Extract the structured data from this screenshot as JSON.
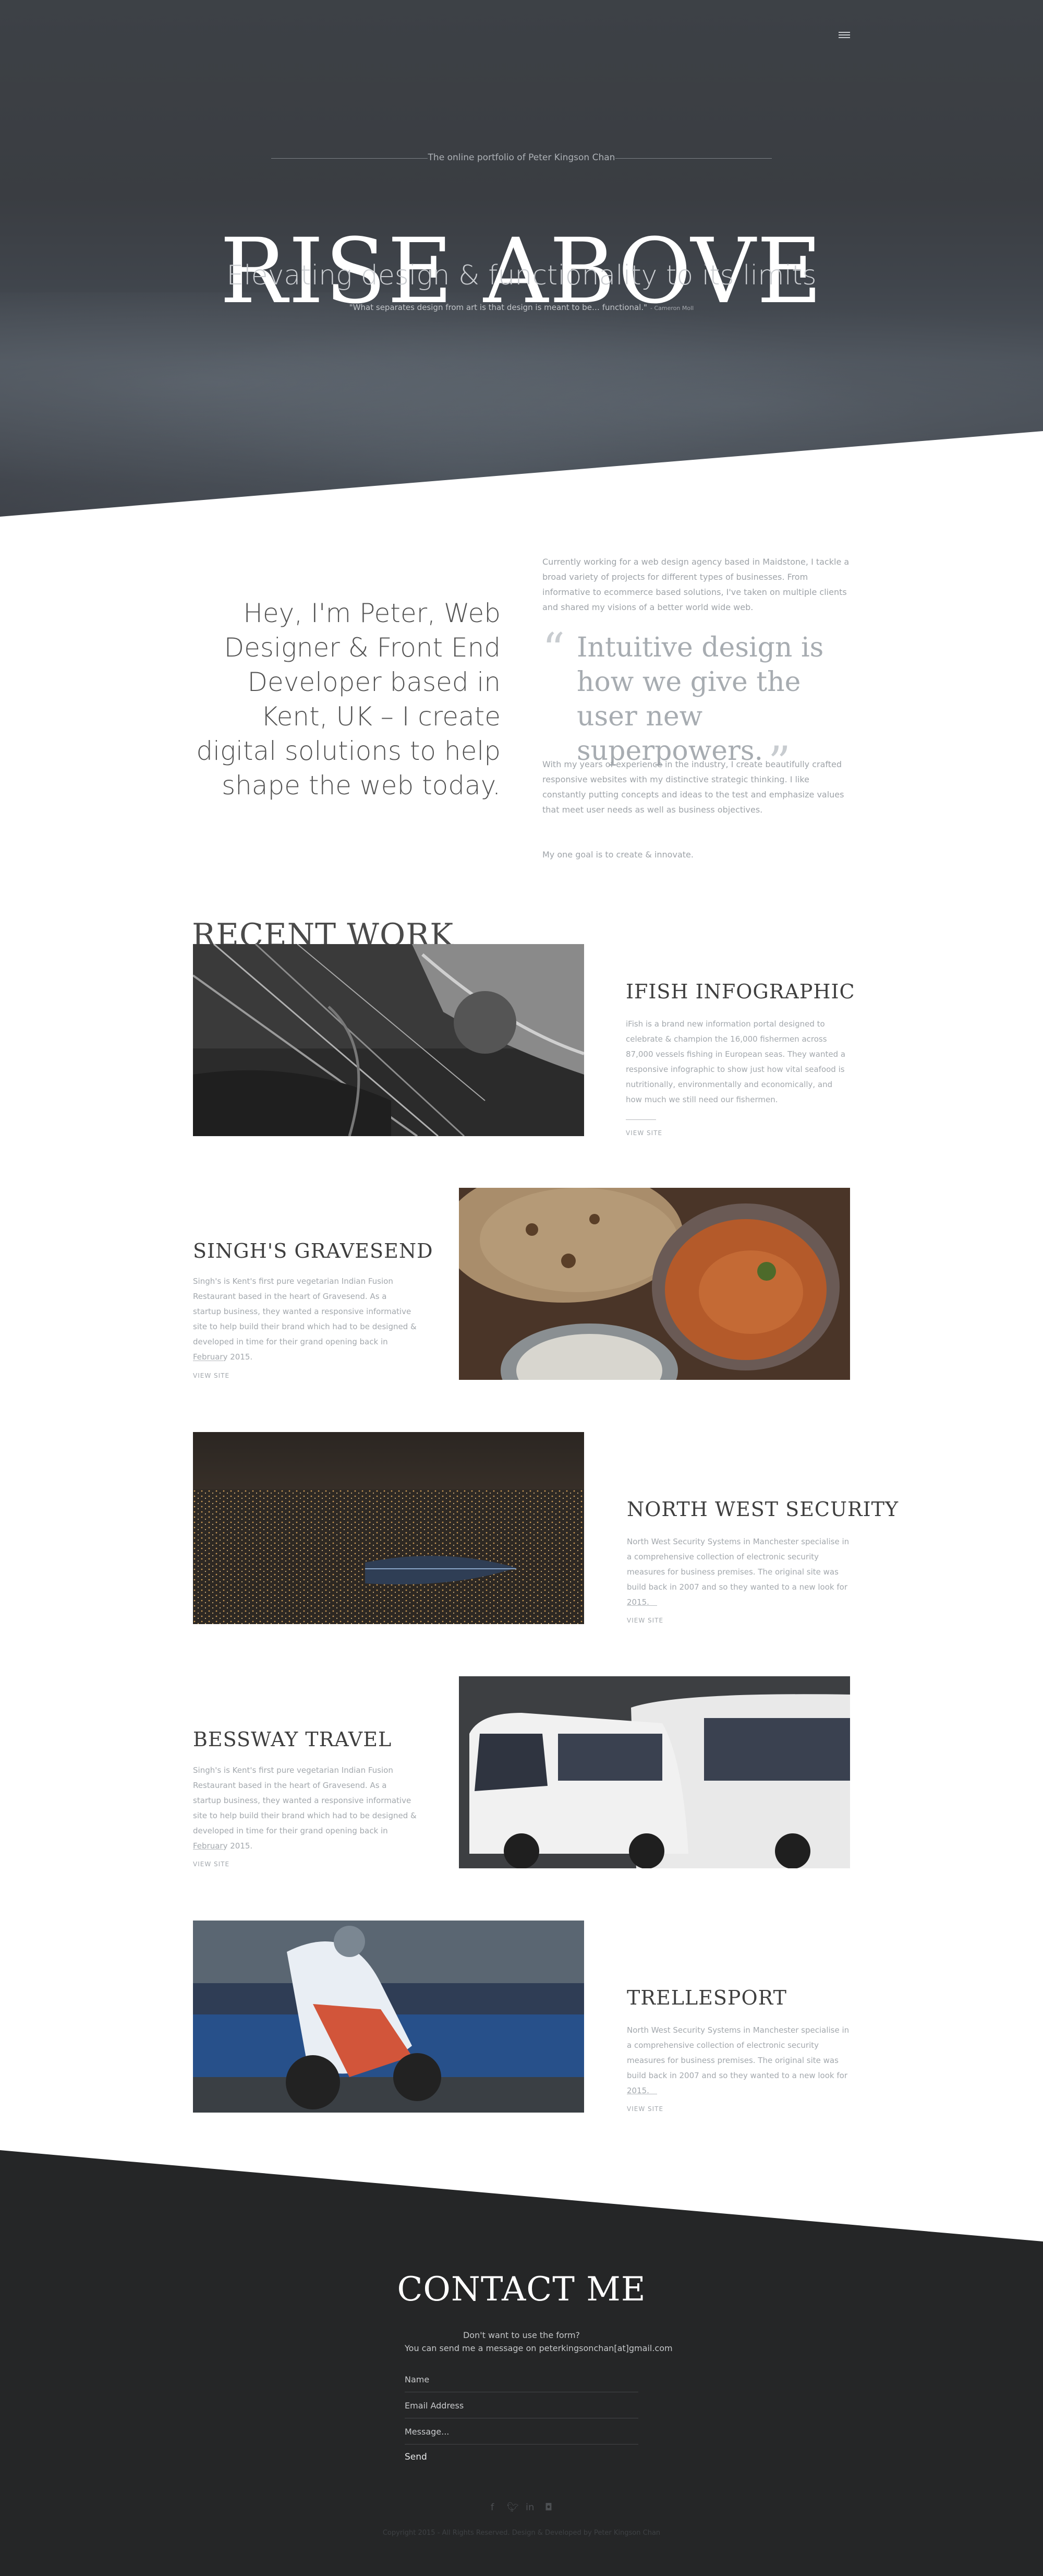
{
  "hero": {
    "tagline": "The online portfolio of Peter Kingson Chan",
    "title": "RISE ABOVE",
    "subtitle": "Elevating design & functionality to its limits",
    "quote": "\"What separates design from art is that design is meant to be… functional.\"",
    "quote_author": "- Cameron Moll",
    "menu_icon": "hamburger-menu-icon"
  },
  "about": {
    "intro": "Hey, I'm Peter, Web Designer & Front End Developer based in Kent, UK – I create digital solutions to help shape the web today.",
    "paragraph1": "Currently working for a web design agency based in Maidstone, I tackle a broad variety of projects for different types of businesses. From informative to ecommerce based solutions, I've taken on multiple clients and shared my visions of a better world wide web.",
    "pull_quote": "Intuitive design is how we give the user new superpowers.",
    "paragraph2": "With my years of experience in the industry, I create beautifully crafted responsive websites with my distinctive strategic thinking. I like constantly putting concepts and ideas to the test and emphasize values that meet user needs as well as business objectives.",
    "paragraph3": "My one goal is to create & innovate."
  },
  "work": {
    "heading": "RECENT WORK",
    "projects": [
      {
        "title": "IFISH INFOGRAPHIC",
        "description": "iFish is a brand new information portal designed to celebrate & champion the 16,000 fishermen across 87,000 vessels fishing in European seas. They wanted a responsive infographic to show just how vital seafood is nutritionally, environmentally and economically, and how much we still need our fishermen.",
        "link": "VIEW SITE"
      },
      {
        "title": "SINGH'S GRAVESEND",
        "description": "Singh's is Kent's first pure vegetarian Indian Fusion Restaurant based in the heart of Gravesend. As a startup business, they wanted a responsive informative site to help build their brand which had to be designed & developed in time for their grand opening back in February 2015.",
        "link": "VIEW SITE"
      },
      {
        "title": "NORTH WEST SECURITY",
        "description": "North West Security Systems in Manchester specialise in a comprehensive collection of electronic security measures for business premises. The original site was build back in 2007 and so they wanted to a new look for 2015.",
        "link": "VIEW SITE"
      },
      {
        "title": "BESSWAY TRAVEL",
        "description": "Singh's is Kent's first pure vegetarian Indian Fusion Restaurant based in the heart of Gravesend. As a startup business, they wanted a responsive informative site to help build their brand which had to be designed & developed in time for their grand opening back in February 2015.",
        "link": "VIEW SITE"
      },
      {
        "title": "TRELLESPORT",
        "description": "North West Security Systems in Manchester specialise in a comprehensive collection of electronic security measures for business premises. The original site was build back in 2007 and so they wanted to a new look for 2015.",
        "link": "VIEW SITE"
      }
    ]
  },
  "contact": {
    "title": "CONTACT ME",
    "note1": "Don't want to use the form?",
    "note2": "You can send me a message on peterkingsonchan[at]gmail.com",
    "name_placeholder": "Name",
    "email_placeholder": "Email Address",
    "message_placeholder": "Message...",
    "send_label": "Send",
    "socials": [
      "facebook-icon",
      "twitter-icon",
      "linkedin-icon",
      "instagram-icon"
    ],
    "copyright": "Copyright 2015 - All Rights Reserved. Design & Developed by Peter Kingson Chan"
  },
  "colors": {
    "hero_bg": "#3d4146",
    "contact_bg": "#252627",
    "body_text": "#9ea3a8",
    "heading_text": "#3f3f3f"
  }
}
